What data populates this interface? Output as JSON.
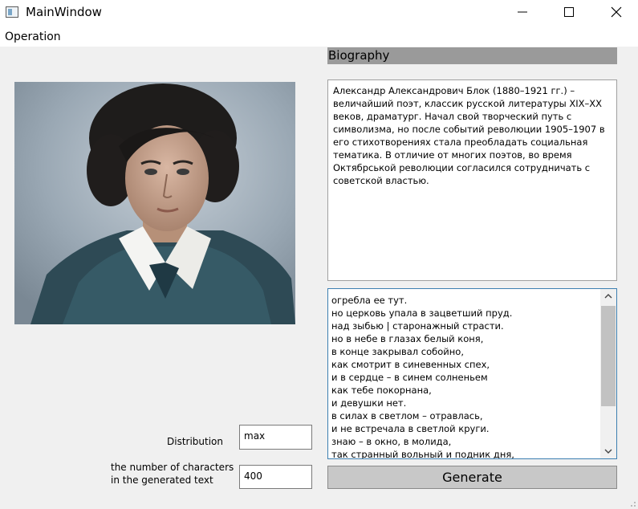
{
  "window": {
    "title": "MainWindow"
  },
  "menu": {
    "items": [
      "Operation"
    ]
  },
  "biography": {
    "header": "Biography",
    "text": "Александр Александрович Блок (1880–1921 гг.) – величайший поэт, классик русской литературы XIX–XX веков, драматург. Начал свой творческий путь с символизма, но после событий революции 1905–1907 в его стихотворениях стала преобладать социальная тематика. В отличие от многих поэтов, во время Октябрськой революции согласился сотрудничать с советской властью."
  },
  "generated": {
    "lines": [
      "огребла ее тут.",
      "но церковь упала в зацветший пруд.",
      "над зыбью |  старонажный страсти.",
      "но в небе в глазах белый коня,",
      "в конце закрывал собойно,",
      "как смотрит в синевенных спех,",
      "и в сердце – в синем солненьем",
      "как тебе покорнана,",
      "и девушки нет.",
      "в силах в светлом – отравлась,",
      "и не встречала в светлой круги.",
      "знаю – в окно, в молида,",
      "так странный вольный и подник дня,"
    ]
  },
  "controls": {
    "distribution_label": "Distribution",
    "distribution_value": "max",
    "chars_label_line1": "the number of characters",
    "chars_label_line2": "in the generated text",
    "chars_value": "400",
    "generate_label": "Generate"
  },
  "icons": {
    "app": "app-window-icon",
    "minimize": "minimize-icon",
    "maximize": "maximize-icon",
    "close": "close-icon",
    "scroll_up": "chevron-up-icon",
    "scroll_down": "chevron-down-icon"
  },
  "colors": {
    "header_bar": "#9a9a9a",
    "focus_border": "#3c7fb1",
    "button_bg": "#c8c8c8"
  }
}
